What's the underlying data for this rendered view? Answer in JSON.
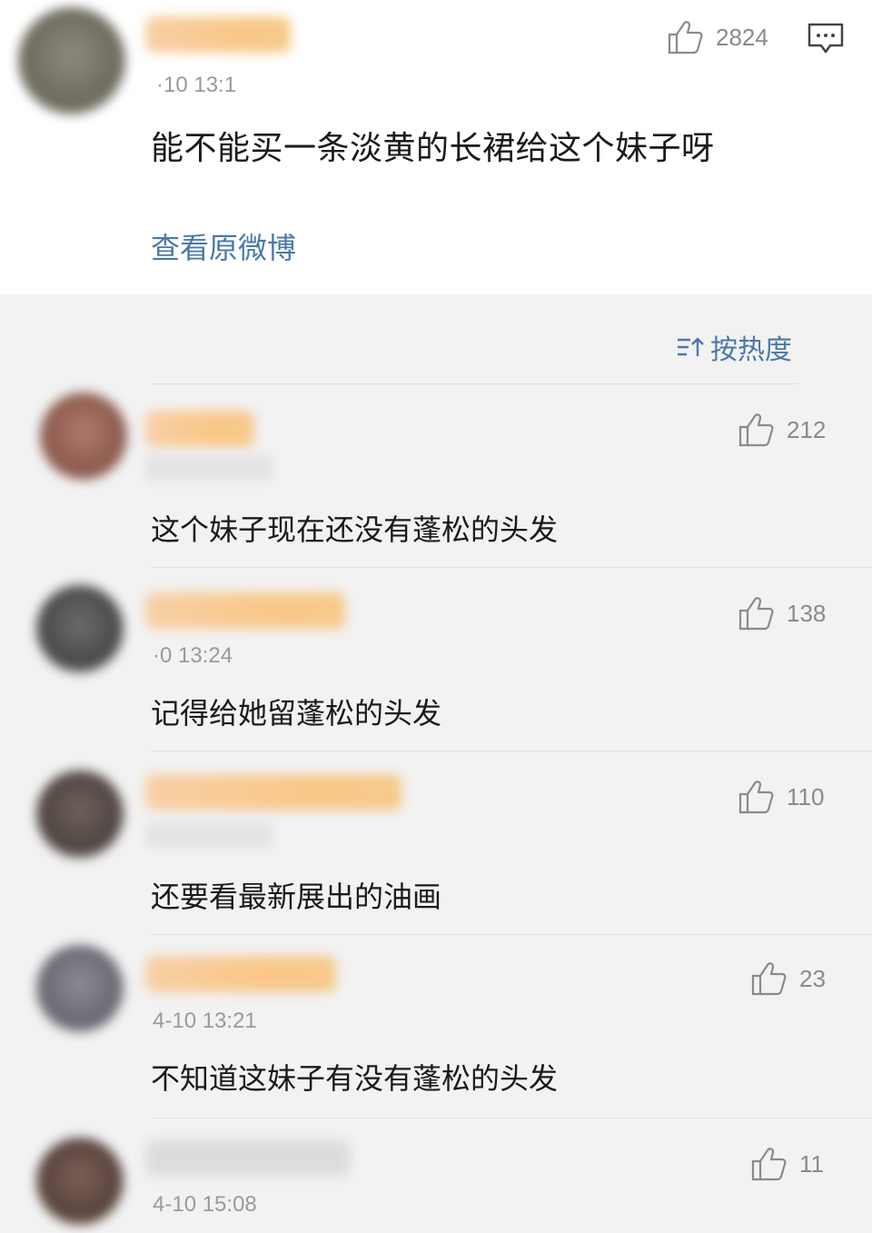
{
  "post": {
    "likes": "2824",
    "text": "能不能买一条淡黄的长裙给这个妹子呀",
    "time": "·10 13:1",
    "view_original": "查看原微博"
  },
  "sort": {
    "label": "按热度",
    "icon": "sort-icon"
  },
  "comments": [
    {
      "text": "这个妹子现在还没有蓬松的头发",
      "likes": "212",
      "time": ""
    },
    {
      "text": "记得给她留蓬松的头发",
      "likes": "138",
      "time": "·0 13:24"
    },
    {
      "text": "还要看最新展出的油画",
      "likes": "110",
      "time": ""
    },
    {
      "text": "不知道这妹子有没有蓬松的头发",
      "likes": "23",
      "time": "4-10 13:21"
    },
    {
      "text": "",
      "likes": "11",
      "time": "4-10 15:08"
    }
  ],
  "colors": {
    "link": "#4a78a8",
    "background": "#f2f2f2",
    "card": "#ffffff",
    "meta": "#8a8a8a"
  }
}
